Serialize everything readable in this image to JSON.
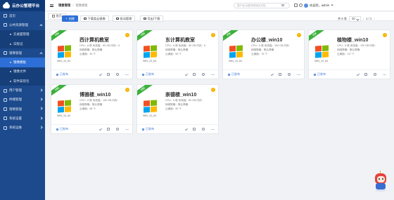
{
  "app": {
    "title": "云办公管理平台"
  },
  "sidebar": {
    "items": [
      {
        "label": "首页",
        "level": 0,
        "state": "normal",
        "icon": "home-icon"
      },
      {
        "label": "公共资源管理",
        "level": 0,
        "state": "expanded",
        "icon": "resource-icon"
      },
      {
        "label": "云桌面管理",
        "level": 1,
        "state": "normal"
      },
      {
        "label": "日程记",
        "level": 1,
        "state": "normal"
      },
      {
        "label": "镜像管理",
        "level": 0,
        "state": "expanded",
        "icon": "image-icon"
      },
      {
        "label": "镜像模板",
        "level": 1,
        "state": "active"
      },
      {
        "label": "镜像文件",
        "level": 1,
        "state": "normal"
      },
      {
        "label": "软件安装包",
        "level": 1,
        "state": "normal"
      },
      {
        "label": "用户管理",
        "level": 0,
        "state": "collapsed",
        "icon": "user-icon"
      },
      {
        "label": "终端管理",
        "level": 0,
        "state": "collapsed",
        "icon": "terminal-icon"
      },
      {
        "label": "策略管理",
        "level": 0,
        "state": "collapsed",
        "icon": "policy-icon"
      },
      {
        "label": "系统设置",
        "level": 0,
        "state": "collapsed",
        "icon": "settings-icon"
      },
      {
        "label": "系统运维",
        "level": 0,
        "state": "collapsed",
        "icon": "ops-icon"
      }
    ]
  },
  "header": {
    "breadcrumb": [
      "镜像管理",
      "镜像模板"
    ],
    "search_placeholder": "搜产品,功能项或相关文档",
    "user_label": "欢迎您，admin"
  },
  "tabs": [
    {
      "label": "首页",
      "icon": "home-icon"
    }
  ],
  "toolbar": {
    "create": "创建",
    "download_client": "下载类云镜像",
    "group_manage": "驱动管理",
    "import_export": "导出/下载",
    "page_size_prefix": "共 5 条",
    "page_size": "20",
    "page_indicator": "1 / 1"
  },
  "cards": [
    {
      "title": "西计算机教室",
      "os_version": "WIN_10_64",
      "ribbon": "VDI",
      "status": "已发布",
      "cpu": "CPU：6 核",
      "mem": "系统盘：80 GB",
      "mem_extra": "内存：6",
      "net": "网络策略：默认策略",
      "disk": "云桌面：44 个"
    },
    {
      "title": "东计算机教室",
      "os_version": "WIN_10_64",
      "ribbon": "VDI",
      "status": "已发布",
      "cpu": "CPU：6 核",
      "mem": "系统盘：80 GB",
      "mem_extra": "内存：6",
      "net": "网络策略：默认策略",
      "disk": "云桌面：60 个"
    },
    {
      "title": "办公楼_win10",
      "os_version": "WIN_10_64",
      "ribbon": "VDI",
      "status": "已发布",
      "cpu": "CPU：6 核",
      "mem": "系统盘：100 GB",
      "mem_extra": "内存：",
      "net": "网络策略：默认策略",
      "disk": "云桌面：76 个"
    },
    {
      "title": "植物楼_win10",
      "os_version": "WIN_10_64",
      "ribbon": "VDI",
      "status": "已发布",
      "cpu": "CPU：6 核",
      "mem": "系统盘：100 GB",
      "mem_extra": "内存：",
      "net": "网络策略：默认策略",
      "disk": "云桌面：117 个"
    },
    {
      "title": "博雅楼_win10",
      "os_version": "WIN_10_64",
      "ribbon": "VDI",
      "status": "已发布",
      "cpu": "CPU：6 核",
      "mem": "系统盘：100 GB",
      "mem_extra": "内存：",
      "net": "网络策略：默认策略",
      "disk": "云桌面：68 个"
    },
    {
      "title": "崇德楼_win10",
      "os_version": "WIN_10_64",
      "ribbon": "VDI",
      "status": "已发布",
      "cpu": "CPU：6 核",
      "mem": "系统盘：80 GB",
      "mem_extra": "内存：",
      "net": "网络策略：默认策略",
      "disk": "云桌面：60 个"
    }
  ],
  "colors": {
    "sidebar": "#1c4a8c",
    "accent": "#2d6fd6",
    "ribbon": "#3cb13c",
    "badge": "#f5b300"
  }
}
